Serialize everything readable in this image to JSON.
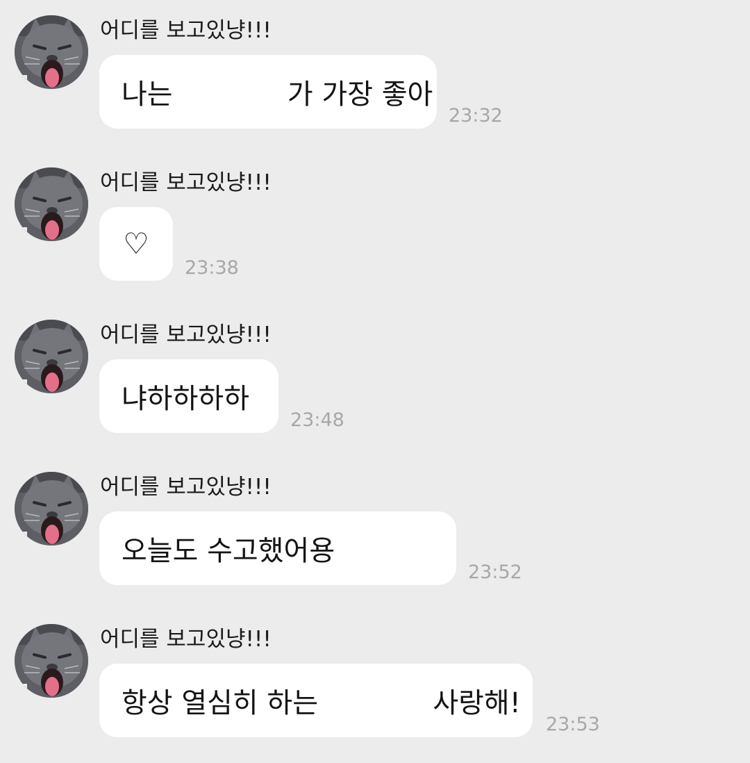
{
  "messages": [
    {
      "sender": "어디를 보고있냥!!!",
      "text": "나는             가 가장 좋아",
      "time": "23:32"
    },
    {
      "sender": "어디를 보고있냥!!!",
      "text": "♡",
      "time": "23:38"
    },
    {
      "sender": "어디를 보고있냥!!!",
      "text": "냐하하하하",
      "time": "23:48"
    },
    {
      "sender": "어디를 보고있냥!!!",
      "text": "오늘도 수고했어용",
      "time": "23:52"
    },
    {
      "sender": "어디를 보고있냥!!!",
      "text": "항상 열심히 하는             사랑해!",
      "time": "23:53"
    }
  ],
  "colors": {
    "background": "#ececec",
    "bubble": "#ffffff",
    "time_text": "#a7a7a7"
  }
}
